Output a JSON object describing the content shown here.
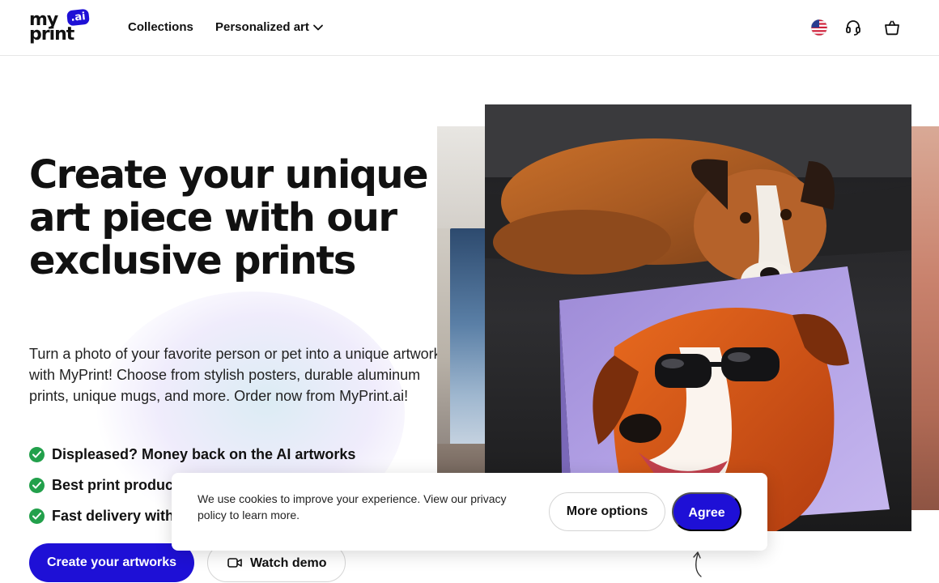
{
  "header": {
    "logo": {
      "line1": "my",
      "line2": "print",
      "badge": ".ai"
    },
    "nav": {
      "collections": "Collections",
      "personalized": "Personalized art"
    },
    "icons": [
      "us-flag-icon",
      "headset-icon",
      "shopping-basket-icon"
    ]
  },
  "hero": {
    "title": "Create your unique art piece with our exclusive prints",
    "description": "Turn a photo of your favorite person or pet into a unique artwork with MyPrint! Choose from stylish posters, durable aluminum prints, unique mugs, and more. Order now from MyPrint.ai!",
    "bullets": [
      "Displeased? Money back on the AI artworks",
      "Best print products",
      "Fast delivery within"
    ],
    "primary_button": "Create your artworks",
    "demo_button": "Watch demo"
  },
  "cookie": {
    "text": "We use cookies to improve your experience. View our privacy policy to learn more.",
    "more_options": "More options",
    "agree": "Agree"
  },
  "colors": {
    "accent": "#1e10d6",
    "check_green": "#22a04b",
    "text": "#111111"
  }
}
